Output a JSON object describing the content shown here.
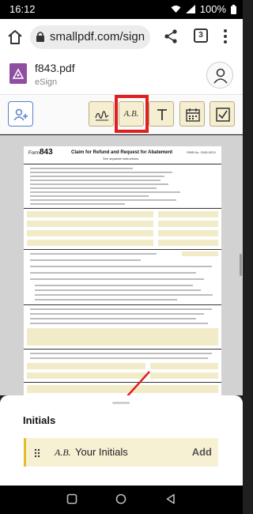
{
  "status_bar": {
    "time": "16:12",
    "battery": "100%",
    "icons": [
      "wifi-icon",
      "signal-icon",
      "battery-icon"
    ]
  },
  "browser": {
    "url": "smallpdf.com/sign",
    "tab_count": "3",
    "icons": [
      "home-icon",
      "lock-icon",
      "share-icon",
      "tabs-icon",
      "more-vert-icon"
    ]
  },
  "app": {
    "file_name": "f843.pdf",
    "file_subtitle": "eSign",
    "icons": [
      "pdf-file-icon",
      "user-account-icon"
    ]
  },
  "toolbar": {
    "initials_label": "A.B.",
    "selected_tool": "initials",
    "highlight_color": "#e02020",
    "tools": [
      "add-signer-icon",
      "signature-icon",
      "initials-tool",
      "text-icon",
      "date-icon",
      "checkbox-icon"
    ]
  },
  "document": {
    "form_no": "Form",
    "form_number": "843",
    "form_title": "Claim for Refund and Request for Abatement",
    "form_subtitle": "See separate instructions.",
    "omb": "OMB No. 1545-0024"
  },
  "sheet": {
    "title": "Initials",
    "item_initials": "A.B.",
    "item_label": "Your Initials",
    "add_label": "Add",
    "accent_color": "#e2bd2d"
  },
  "annotation": {
    "arrow_color": "#e02020"
  }
}
